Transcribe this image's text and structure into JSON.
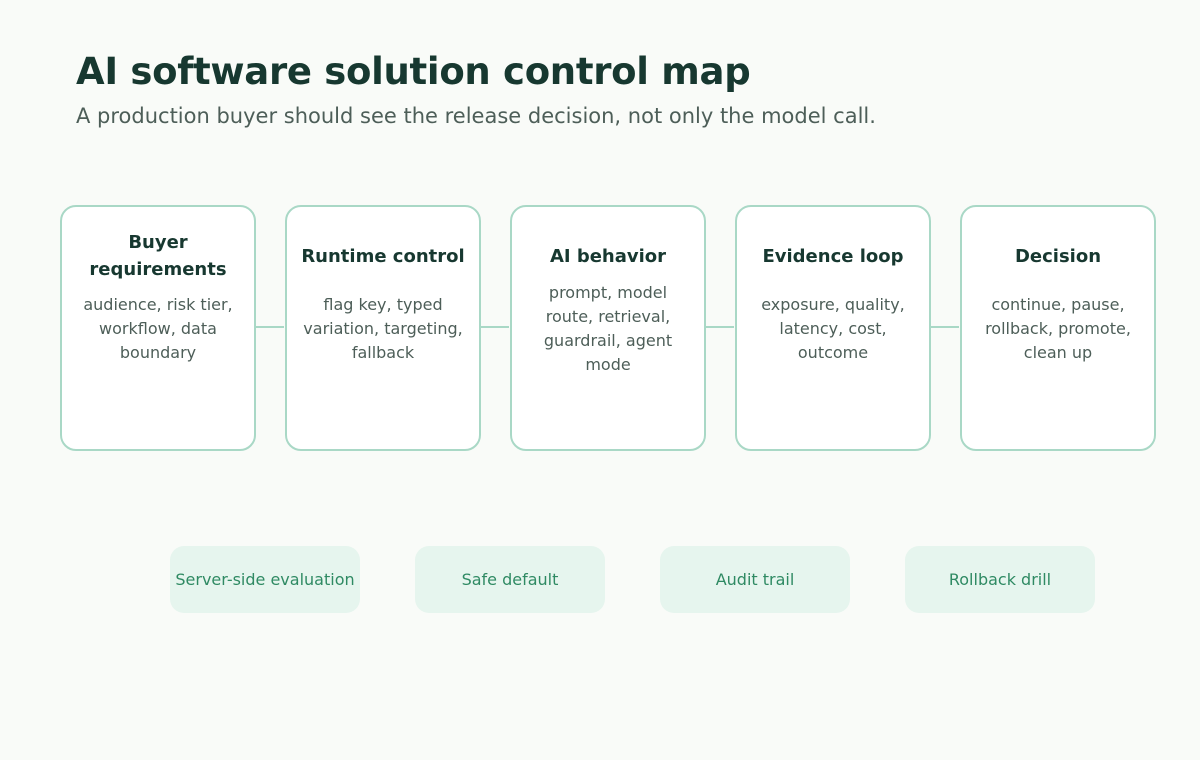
{
  "header": {
    "title": "AI software solution control map",
    "subtitle": "A production buyer should see the release decision, not only the model call."
  },
  "stages": [
    {
      "title": "Buyer requirements",
      "body": "audience, risk tier, workflow, data boundary"
    },
    {
      "title": "Runtime control",
      "body": "flag key, typed variation, targeting, fallback"
    },
    {
      "title": "AI behavior",
      "body": "prompt, model route, retrieval, guardrail, agent mode"
    },
    {
      "title": "Evidence loop",
      "body": "exposure, quality, latency, cost, outcome"
    },
    {
      "title": "Decision",
      "body": "continue, pause, rollback, promote, clean up"
    }
  ],
  "pills": [
    {
      "label": "Server-side evaluation"
    },
    {
      "label": "Safe default"
    },
    {
      "label": "Audit trail"
    },
    {
      "label": "Rollback drill"
    }
  ],
  "colors": {
    "background": "#f9fbf8",
    "title": "#173830",
    "body_text": "#4d5e58",
    "card_border": "#a9d8c6",
    "pill_background": "#e6f5ee",
    "pill_text": "#2f8a63"
  }
}
